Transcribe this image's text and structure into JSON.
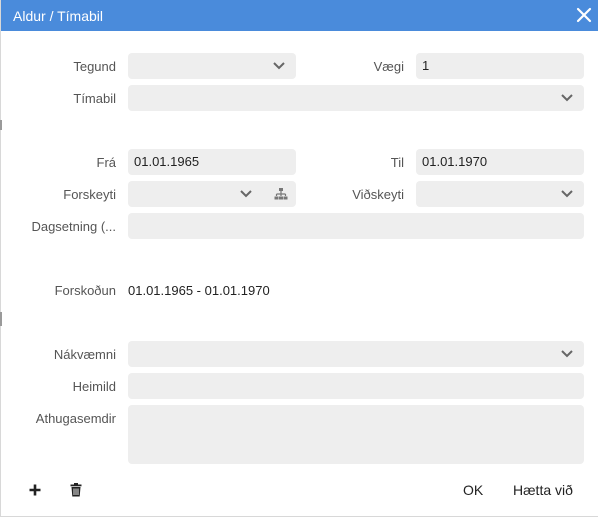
{
  "dialog": {
    "title": "Aldur / Tímabil",
    "close_icon": "close-icon"
  },
  "form": {
    "tegund": {
      "label": "Tegund",
      "value": ""
    },
    "vaegi": {
      "label": "Vægi",
      "value": "1"
    },
    "timabil": {
      "label": "Tímabil",
      "value": ""
    },
    "fra": {
      "label": "Frá",
      "value": "01.01.1965"
    },
    "til": {
      "label": "Til",
      "value": "01.01.1970"
    },
    "forskeyti": {
      "label": "Forskeyti",
      "value": ""
    },
    "vidskeyti": {
      "label": "Viðskeyti",
      "value": ""
    },
    "dagsetning": {
      "label": "Dagsetning (...",
      "value": ""
    },
    "forskodun": {
      "label": "Forskoðun",
      "value": "01.01.1965 - 01.01.1970"
    },
    "nakvaemni": {
      "label": "Nákvæmni",
      "value": ""
    },
    "heimild": {
      "label": "Heimild",
      "value": ""
    },
    "athugasemdir": {
      "label": "Athugasemdir",
      "value": ""
    }
  },
  "footer": {
    "ok_label": "OK",
    "cancel_label": "Hætta við",
    "add_icon": "plus-icon",
    "delete_icon": "trash-icon"
  },
  "colors": {
    "titlebar": "#4a8bdb",
    "field_bg": "#eeeeee"
  }
}
